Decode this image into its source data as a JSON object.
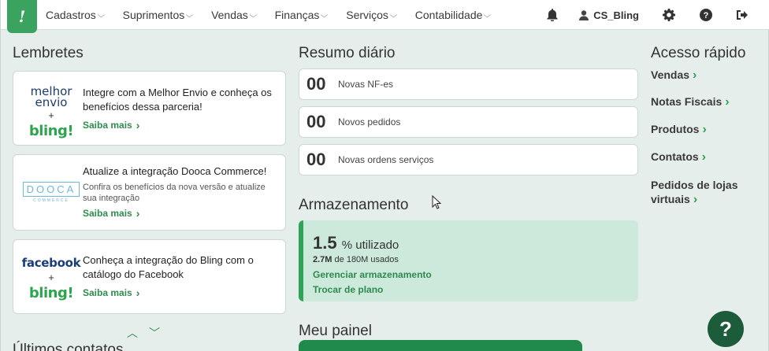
{
  "nav": {
    "logo": "!",
    "items": [
      {
        "label": "Cadastros"
      },
      {
        "label": "Suprimentos"
      },
      {
        "label": "Vendas"
      },
      {
        "label": "Finanças"
      },
      {
        "label": "Serviços"
      },
      {
        "label": "Contabilidade"
      }
    ],
    "username": "CS_Bling"
  },
  "reminders": {
    "title": "Lembretes",
    "cards": [
      {
        "logo_top": "melhor envio",
        "plus": "+",
        "logo_bottom": "bling!",
        "headline": "Integre com a Melhor Envio e conheça os benefícios dessa parceria!",
        "link": "Saiba mais"
      },
      {
        "logo_top": "DOOCA",
        "logo_sub": "COMMERCE",
        "headline": "Atualize a integração Dooca Commerce!",
        "sub": "Confira os benefícios da nova versão e atualize sua integração",
        "link": "Saiba mais"
      },
      {
        "logo_top": "facebook",
        "plus": "+",
        "logo_bottom": "bling!",
        "headline": "Conheça a integração do Bling com o catálogo do Facebook",
        "link": "Saiba mais"
      }
    ],
    "next_section_title": "Últimos contatos"
  },
  "summary": {
    "title": "Resumo diário",
    "items": [
      {
        "count": "00",
        "label": "Novas NF-es"
      },
      {
        "count": "00",
        "label": "Novos pedidos"
      },
      {
        "count": "00",
        "label": "Novas ordens serviços"
      }
    ]
  },
  "storage": {
    "title": "Armazenamento",
    "used_value": "1.5",
    "used_unit": "% utilizado",
    "used_amount": "2.7M",
    "total_text": "de 180M usados",
    "manage_link": "Gerenciar armazenamento",
    "plan_link": "Trocar de plano"
  },
  "panel": {
    "title": "Meu painel"
  },
  "quick_access": {
    "title": "Acesso rápido",
    "links": [
      {
        "label": "Vendas"
      },
      {
        "label": "Notas Fiscais"
      },
      {
        "label": "Produtos"
      },
      {
        "label": "Contatos"
      },
      {
        "label": "Pedidos de lojas virtuais"
      }
    ]
  },
  "help": {
    "label": "?"
  },
  "colors": {
    "brand_green": "#3aa35f",
    "link_green": "#2e8b4d",
    "storage_bg": "#cce9dc",
    "page_bg": "#e6eeeb"
  }
}
